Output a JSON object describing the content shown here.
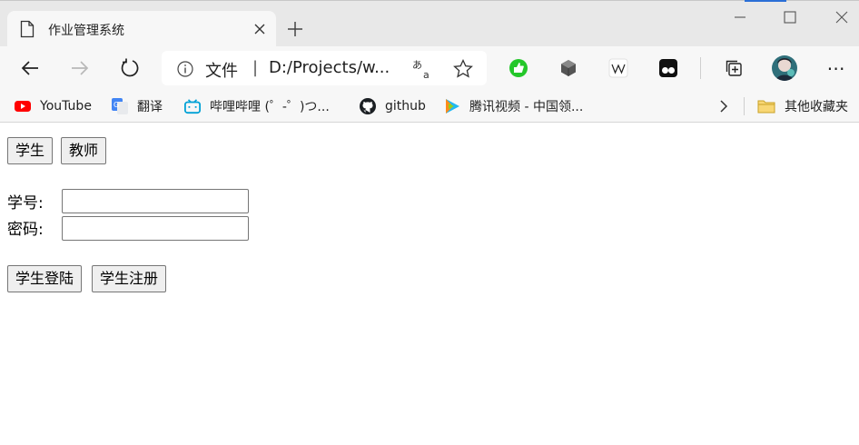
{
  "browser": {
    "tab": {
      "title": "作业管理系统"
    },
    "omnibox": {
      "file_label": "文件",
      "separator": "|",
      "url": "D:/Projects/w..."
    },
    "translate_glyph_top": "あ",
    "translate_glyph_bottom": "a",
    "more_label": "⋯",
    "accent_color": "#2b6fd6"
  },
  "bookmarks": [
    {
      "label": "YouTube",
      "icon": "youtube-icon"
    },
    {
      "label": "翻译",
      "icon": "google-translate-icon"
    },
    {
      "label": "哔哩哔哩 (゜-゜)つ...",
      "icon": "bilibili-icon"
    },
    {
      "label": "github",
      "icon": "github-icon"
    },
    {
      "label": "腾讯视频 - 中国领...",
      "icon": "tencent-video-icon"
    }
  ],
  "bookmarks_other": {
    "label": "其他收藏夹",
    "icon": "folder-icon"
  },
  "page": {
    "role_tabs": {
      "student": "学生",
      "teacher": "教师"
    },
    "form": {
      "id_label": "学号:",
      "id_value": "",
      "password_label": "密码:",
      "password_value": ""
    },
    "actions": {
      "login": "学生登陆",
      "register": "学生注册"
    }
  }
}
